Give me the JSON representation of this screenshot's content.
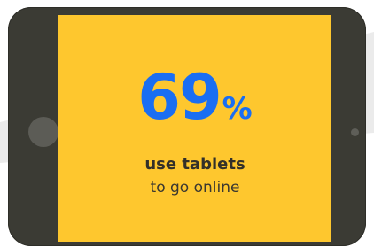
{
  "stat": {
    "number": "69",
    "unit": "%"
  },
  "caption": {
    "line1": "use tablets",
    "line2": "to go online"
  },
  "colors": {
    "screen": "#fec72e",
    "stat": "#1a6ef2",
    "device": "#3b3b34",
    "background_band": "#ebebeb"
  },
  "icons": {
    "home_button": "circle",
    "camera": "circle"
  }
}
